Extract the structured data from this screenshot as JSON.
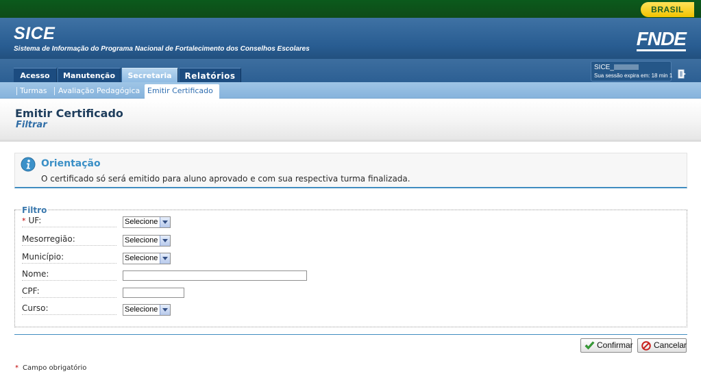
{
  "gov_bar": {
    "badge": "BRASIL"
  },
  "header": {
    "app_name": "SICE",
    "app_subtitle": "Sistema de Informação do Programa Nacional de Fortalecimento dos Conselhos Escolares",
    "logo": "FNDE"
  },
  "nav": {
    "tabs": [
      {
        "label": "Acesso",
        "active": false
      },
      {
        "label": "Manutenção",
        "active": false
      },
      {
        "label": "Secretaria",
        "active": true
      },
      {
        "label": "Relatórios",
        "active": false
      }
    ]
  },
  "session": {
    "user_prefix": "SICE_",
    "expires": "Sua sessão expira em: 18 min 1",
    "logout_icon": "logout-icon"
  },
  "subnav": {
    "items": [
      {
        "label": "Turmas",
        "active": false
      },
      {
        "label": "Avaliação Pedagógica",
        "active": false
      },
      {
        "label": "Emitir Certificado",
        "active": true
      }
    ]
  },
  "page": {
    "title": "Emitir Certificado",
    "subtitle": "Filtrar"
  },
  "orientation": {
    "icon": "info-icon",
    "title": "Orientação",
    "text": "O certificado só será emitido para aluno aprovado e com sua respectiva turma finalizada."
  },
  "filter": {
    "legend": "Filtro",
    "required_mark": "*",
    "fields": {
      "uf": {
        "label": "UF:",
        "value": "Selecione",
        "required": true
      },
      "mesorregiao": {
        "label": "Mesorregião:",
        "value": "Selecione"
      },
      "municipio": {
        "label": "Município:",
        "value": "Selecione"
      },
      "nome": {
        "label": "Nome:",
        "value": ""
      },
      "cpf": {
        "label": "CPF:",
        "value": ""
      },
      "curso": {
        "label": "Curso:",
        "value": "Selecione"
      }
    }
  },
  "actions": {
    "confirm": "Confirmar",
    "cancel": "Cancelar"
  },
  "footer": {
    "required_mark": "*",
    "required_note": "Campo obrigatório"
  },
  "colors": {
    "header_blue": "#285c91",
    "gov_green": "#0f4b18",
    "accent_blue": "#3f8cc0",
    "required_red": "#c00000"
  }
}
